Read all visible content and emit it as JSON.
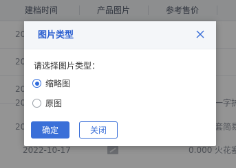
{
  "table": {
    "headers": [
      "建档时间",
      "产品图片",
      "参考售价"
    ],
    "rows": [
      {
        "date": "20",
        "price": "",
        "extra": ""
      },
      {
        "date": "20",
        "price": "",
        "extra": ""
      },
      {
        "date": "20",
        "price": "",
        "extra": ""
      },
      {
        "date": "20",
        "price": "",
        "extra": "一字护"
      },
      {
        "date": "20",
        "price": "",
        "extra": "套简易"
      },
      {
        "date": "2022-10-17",
        "price": "0.000",
        "extra": "火花塞"
      }
    ]
  },
  "dialog": {
    "title": "图片类型",
    "prompt": "请选择图片类型：",
    "options": [
      {
        "label": "缩略图",
        "checked": true
      },
      {
        "label": "原图",
        "checked": false
      }
    ],
    "confirm_label": "确定",
    "close_label": "关闭"
  },
  "colors": {
    "accent": "#3a6fd8",
    "title": "#2b5fd0",
    "overlay": "rgba(0,0,0,0.42)"
  },
  "icons": {
    "close": "close-icon",
    "thumbnail": "image-icon"
  }
}
